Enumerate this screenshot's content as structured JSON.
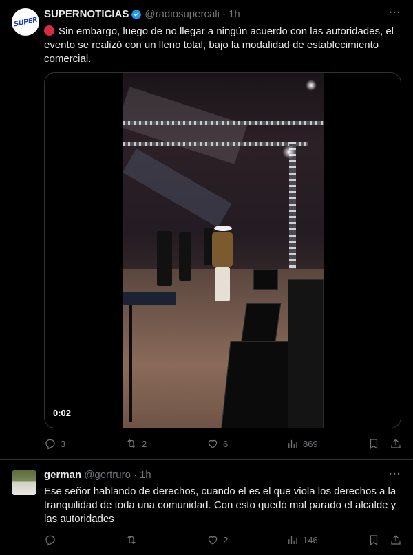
{
  "tweets": [
    {
      "author": {
        "name": "SUPERNOTICIAS",
        "handle": "@radiosupercali",
        "verified": true,
        "logo_text": "SUPER"
      },
      "time": "1h",
      "text": "Sin embargo, luego de no llegar a ningún acuerdo con las autoridades, el evento se realizó con un lleno total, bajo la modalidad de establecimiento comercial.",
      "media": {
        "type": "video",
        "duration": "0:02"
      },
      "stats": {
        "replies": "3",
        "reposts": "2",
        "likes": "6",
        "views": "869"
      }
    },
    {
      "author": {
        "name": "german",
        "handle": "@gertruro",
        "verified": false
      },
      "time": "1h",
      "text": "Ese señor hablando de derechos, cuando el es el que viola los derechos a la tranquilidad de toda una comunidad. Con esto quedó mal parado el alcalde y las autoridades",
      "stats": {
        "replies": "",
        "reposts": "",
        "likes": "2",
        "views": "146"
      }
    }
  ],
  "ui": {
    "more_label": "···",
    "dot": "·"
  },
  "colors": {
    "background": "#000000",
    "text": "#e7e9ea",
    "secondary": "#71767b",
    "verified": "#1d9bf0",
    "border": "#2f3336"
  }
}
